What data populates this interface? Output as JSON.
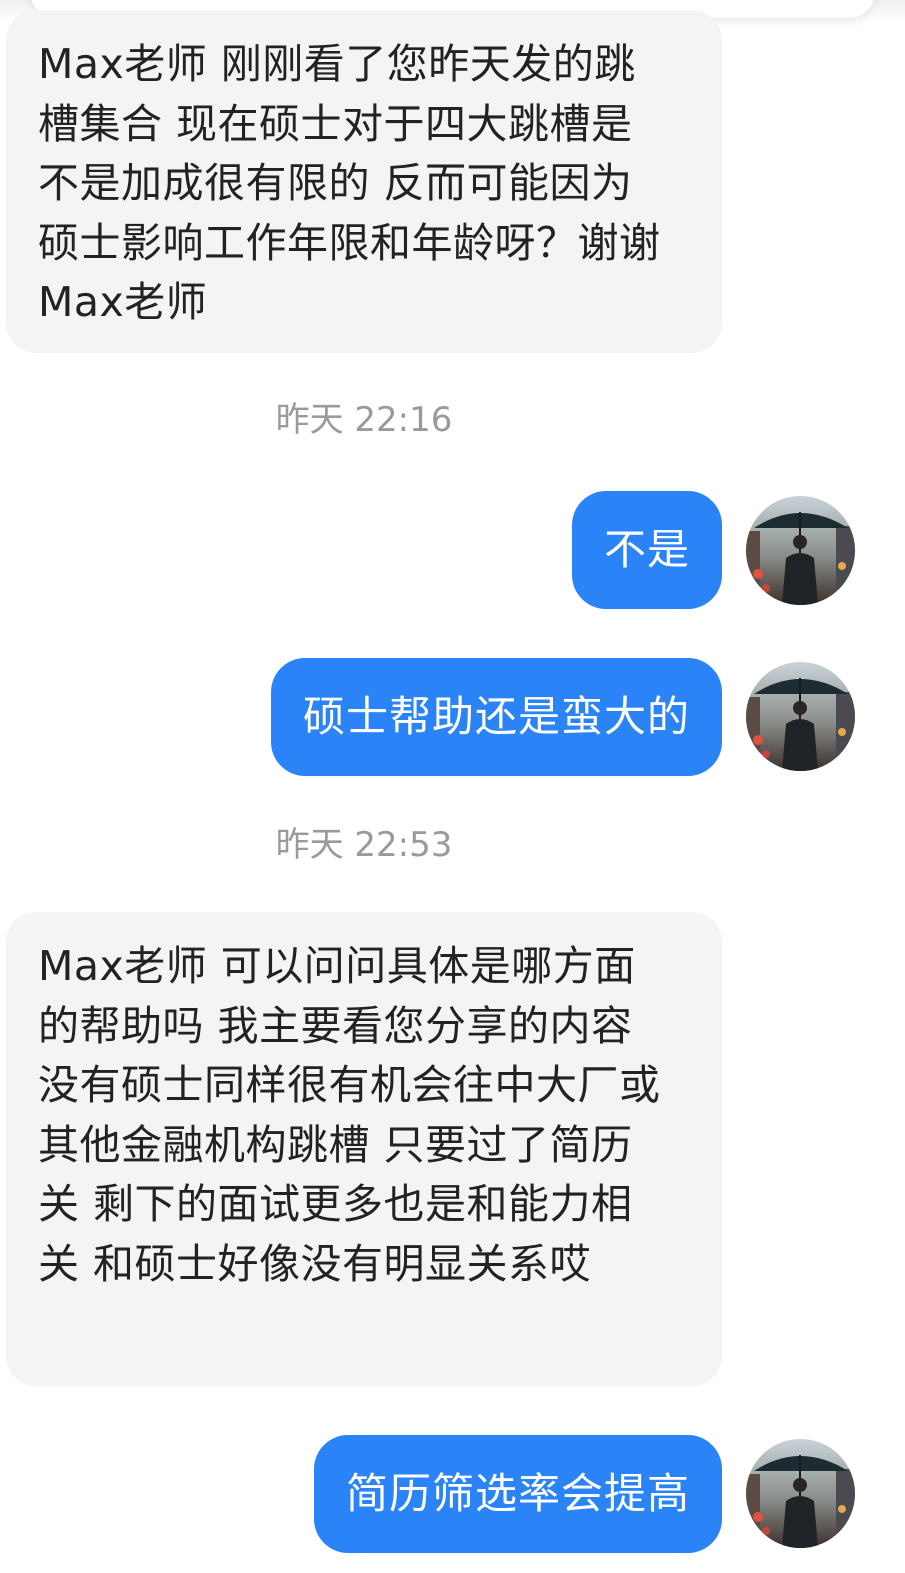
{
  "messages": [
    {
      "side": "incoming",
      "text": "Max老师 刚刚看了您昨天发的跳槽集合 现在硕士对于四大跳槽是不是加成很有限的 反而可能因为硕士影响工作年限和年龄呀？谢谢Max老师"
    },
    {
      "side": "timestamp",
      "text": "昨天 22:16"
    },
    {
      "side": "outgoing",
      "text": "不是"
    },
    {
      "side": "outgoing",
      "text": "硕士帮助还是蛮大的"
    },
    {
      "side": "timestamp",
      "text": "昨天 22:53"
    },
    {
      "side": "incoming",
      "text": "Max老师 可以问问具体是哪方面的帮助吗 我主要看您分享的内容 没有硕士同样很有机会往中大厂或其他金融机构跳槽 只要过了简历关 剩下的面试更多也是和能力相关 和硕士好像没有明显关系哎"
    },
    {
      "side": "outgoing",
      "text": "简历筛选率会提高"
    }
  ],
  "avatar": {
    "icon": "user-avatar-umbrella-man"
  },
  "colors": {
    "outgoing_bubble": "#2b84f7",
    "incoming_bubble": "#f4f4f4",
    "timestamp_text": "#9a9a9a"
  }
}
